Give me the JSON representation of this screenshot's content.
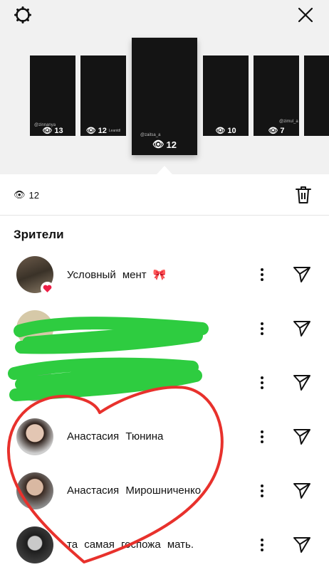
{
  "stories": [
    {
      "handle": "@zinnanya",
      "views": "13"
    },
    {
      "handle": "",
      "views": "12",
      "extra": "Leantdl"
    },
    {
      "handle": "@zaitsa_a",
      "views": "12"
    },
    {
      "handle": "",
      "views": "10"
    },
    {
      "handle": "@zimul_a",
      "views": "7"
    }
  ],
  "stats": {
    "views": "12"
  },
  "section_title": "Зрители",
  "viewers": [
    {
      "name": "Условный мент",
      "emoji": "🎀",
      "liked": true
    },
    {
      "name": "",
      "redacted": true
    },
    {
      "name": "",
      "redacted": true
    },
    {
      "name": "Анастасия Тюнина"
    },
    {
      "name": "Анастасия Мирошниченко"
    },
    {
      "name": "та самая госпожа мать."
    }
  ],
  "colors": {
    "top_bg": "#f1f1f1",
    "story_bg": "#141414",
    "like": "#ed1e46",
    "scribble_green": "#2ecc40",
    "scribble_red": "#e8312c"
  }
}
